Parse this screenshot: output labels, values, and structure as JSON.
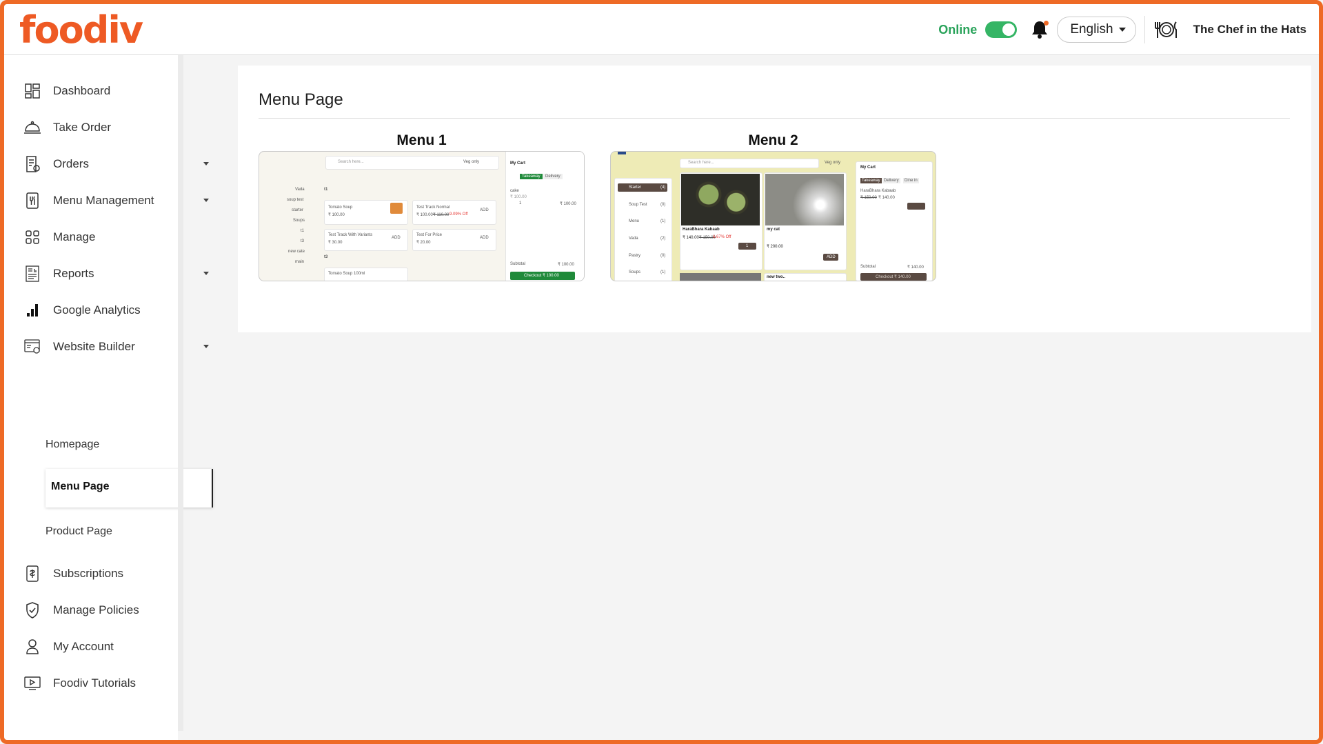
{
  "app": {
    "logo_text": "foodiv",
    "brand_color": "#ee5a24",
    "accent_green": "#29a35a"
  },
  "header": {
    "status_label": "Online",
    "status_toggle_on": true,
    "language": "English",
    "restaurant_name": "The Chef in the Hats",
    "icons": [
      "bell-icon",
      "cutlery-icon",
      "chevron-down-icon"
    ]
  },
  "sidebar": {
    "items": [
      {
        "label": "Dashboard",
        "icon": "dashboard-icon"
      },
      {
        "label": "Take Order",
        "icon": "cloche-icon"
      },
      {
        "label": "Orders",
        "icon": "receipt-icon",
        "expandable": true
      },
      {
        "label": "Menu Management",
        "icon": "menu-card-icon",
        "expandable": true
      },
      {
        "label": "Manage",
        "icon": "grid-icon"
      },
      {
        "label": "Reports",
        "icon": "report-icon",
        "expandable": true
      },
      {
        "label": "Google Analytics",
        "icon": "bar-chart-icon"
      },
      {
        "label": "Website Builder",
        "icon": "website-builder-icon",
        "expandable": true,
        "expanded": true
      },
      {
        "label": "Subscriptions",
        "icon": "subscription-icon"
      },
      {
        "label": "Manage Policies",
        "icon": "shield-icon"
      },
      {
        "label": "My Account",
        "icon": "user-icon"
      },
      {
        "label": "Foodiv Tutorials",
        "icon": "video-icon"
      }
    ],
    "website_builder_sub": [
      "Homepage",
      "Menu Page",
      "Product Page"
    ],
    "active_sub": "Menu Page"
  },
  "main": {
    "page_title": "Menu Page",
    "menus": [
      {
        "title": "Menu 1",
        "preview": {
          "search_placeholder": "Search here...",
          "veg_only": "Veg only",
          "categories": [
            "Vada",
            "soup test",
            "starter",
            "Soups",
            "t1",
            "t3",
            "new cate",
            "main"
          ],
          "section_a": "t1",
          "section_b": "t3",
          "items": [
            {
              "name": "Tomato Soup",
              "price": "₹ 100.00",
              "btn": "ADD"
            },
            {
              "name": "Test Track Normal",
              "price": "₹ 100.00",
              "old_price": "₹ 110.00",
              "discount": "9.09% Off",
              "btn": "ADD"
            },
            {
              "name": "Test Track With Variants",
              "price": "₹ 30.00",
              "btn": "ADD"
            },
            {
              "name": "Test For Price",
              "price": "₹ 20.00",
              "btn": "ADD"
            },
            {
              "name": "Tomato Soup 100ml",
              "price": ""
            }
          ],
          "cart_title": "My Cart",
          "tabs": [
            "Takeaway",
            "Delivery"
          ],
          "cart_item": "cake",
          "cart_item_price": "₹ 100.00",
          "qty": "1",
          "cart_total": "₹ 100.00",
          "subtotal_label": "Subtotal",
          "subtotal": "₹ 100.00",
          "checkout": "Checkout ₹ 100.00"
        }
      },
      {
        "title": "Menu 2",
        "preview": {
          "search_placeholder": "Search here...",
          "veg_only": "Veg only",
          "categories": [
            {
              "name": "Starter",
              "count": "(4)"
            },
            {
              "name": "Soup Test",
              "count": "(0)"
            },
            {
              "name": "Menu",
              "count": "(1)"
            },
            {
              "name": "Vada",
              "count": "(2)"
            },
            {
              "name": "Pastry",
              "count": "(0)"
            },
            {
              "name": "Soups",
              "count": "(1)"
            }
          ],
          "items": [
            {
              "name": "HaraBhara Kabaab",
              "price": "₹ 140.00",
              "old_price": "₹ 150.00",
              "discount": "6.67% Off"
            },
            {
              "name": "my cat",
              "price": "₹ 200.00",
              "btn": "ADD"
            },
            {
              "name": "new two..",
              "price": ""
            }
          ],
          "qty": "1",
          "cart_title": "My Cart",
          "tabs": [
            "Takeaway",
            "Delivery",
            "Dine in"
          ],
          "cart_item": "HaraBhara Kabaab",
          "cart_item_price": "₹ 140.00",
          "cart_item_old": "₹ 150.00",
          "subtotal_label": "Subtotal",
          "subtotal": "₹ 140.00",
          "checkout": "Checkout ₹ 140.00"
        }
      }
    ]
  }
}
